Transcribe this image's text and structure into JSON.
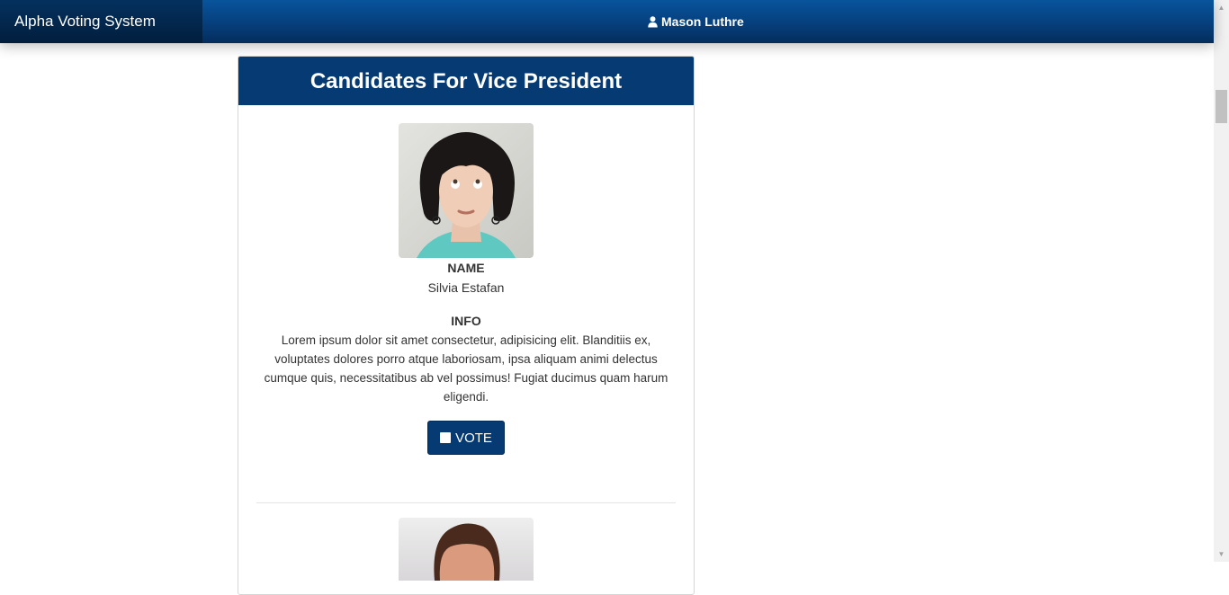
{
  "navbar": {
    "brand": "Alpha Voting System",
    "user_name": "Mason Luthre",
    "user_icon": "user-icon"
  },
  "panel": {
    "title": "Candidates For Vice President"
  },
  "candidates": [
    {
      "name_label": "NAME",
      "name": "Silvia Estafan",
      "info_label": "INFO",
      "info": "Lorem ipsum dolor sit amet consectetur, adipisicing elit. Blanditiis ex, voluptates dolores porro atque laboriosam, ipsa aliquam animi delectus cumque quis, necessitatibus ab vel possimus! Fugiat ducimus quam harum eligendi.",
      "vote_label": "VOTE"
    }
  ],
  "colors": {
    "navbar": "#063f7c",
    "brand_bg": "#021e3d",
    "panel_heading": "#063a73",
    "vote_button": "#063a73"
  }
}
